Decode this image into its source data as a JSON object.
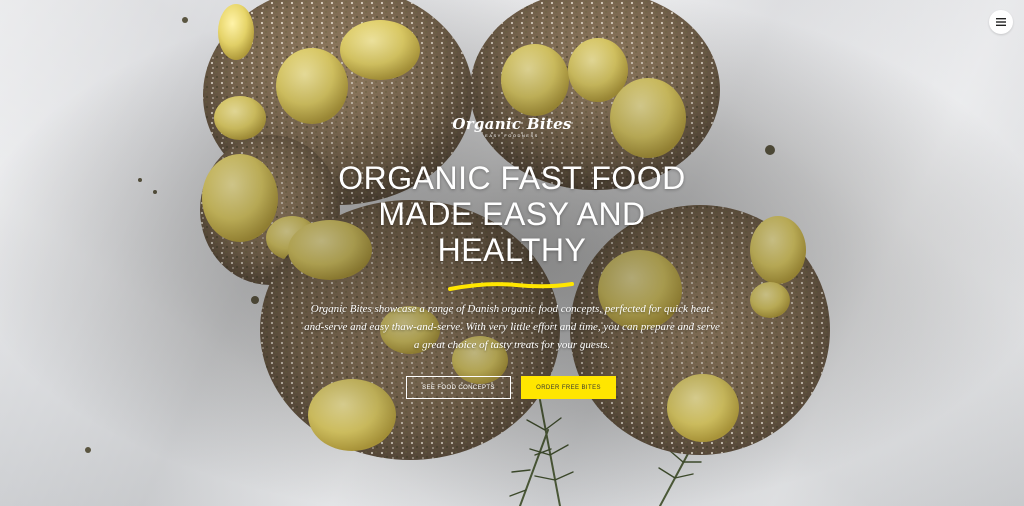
{
  "brand": {
    "name": "Organic Bites",
    "tagline": "Easy Foodness"
  },
  "header": {
    "menu_icon": "hamburger-menu-icon"
  },
  "hero": {
    "headline_line1": "ORGANIC FAST FOOD",
    "headline_line2": "MADE EASY AND",
    "headline_line3": "HEALTHY",
    "description": "Organic Bites showcase a range of Danish organic food concepts, perfected for quick heat-and-serve and easy thaw-and-serve. With very little effort and time, you can prepare and serve a great choice of tasty treats for your guests.",
    "cta_primary": "SEE FOOD CONCEPTS",
    "cta_secondary": "ORDER FREE BITES"
  },
  "colors": {
    "accent": "#ffe600",
    "text_on_image": "#ffffff",
    "paper": "#dcdde0"
  }
}
